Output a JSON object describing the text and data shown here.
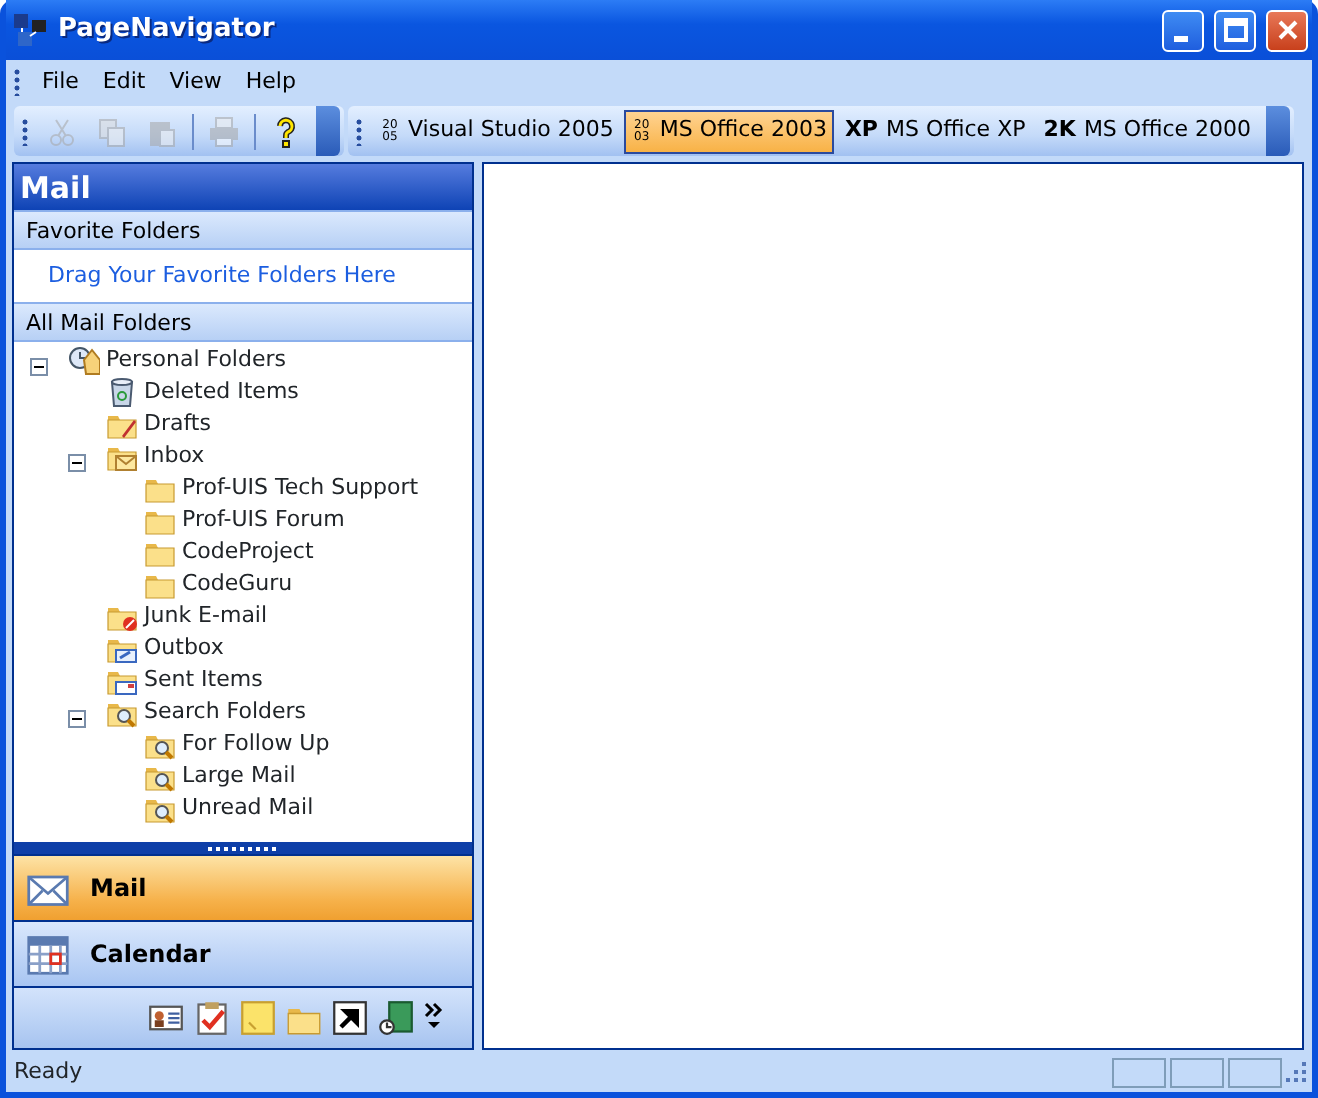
{
  "window": {
    "title": "PageNavigator"
  },
  "menu": [
    "File",
    "Edit",
    "View",
    "Help"
  ],
  "toolbar": [
    {
      "kind": "cut",
      "disabled": true
    },
    {
      "kind": "copy",
      "disabled": true
    },
    {
      "kind": "paste",
      "disabled": true
    },
    {
      "kind": "sep"
    },
    {
      "kind": "print",
      "disabled": true
    },
    {
      "kind": "sep"
    },
    {
      "kind": "help",
      "disabled": false
    }
  ],
  "themes": [
    {
      "badge": "2005",
      "label": "Visual Studio 2005",
      "selected": false
    },
    {
      "badge": "2003",
      "label": "MS Office 2003",
      "selected": true
    },
    {
      "badge": "XP",
      "label": "MS Office XP",
      "selected": false
    },
    {
      "badge": "2K",
      "label": "MS Office 2000",
      "selected": false
    }
  ],
  "pane": {
    "title": "Mail",
    "favorites_header": "Favorite Folders",
    "favorites_hint": "Drag Your Favorite Folders Here",
    "all_header": "All Mail Folders",
    "tree": [
      {
        "label": "Personal Folders",
        "kind": "personal",
        "expanded": true,
        "children": [
          {
            "label": "Deleted Items",
            "kind": "deleted"
          },
          {
            "label": "Drafts",
            "kind": "drafts"
          },
          {
            "label": "Inbox",
            "kind": "inbox",
            "expanded": true,
            "children": [
              {
                "label": "Prof-UIS Tech Support",
                "kind": "folder"
              },
              {
                "label": "Prof-UIS Forum",
                "kind": "folder"
              },
              {
                "label": "CodeProject",
                "kind": "folder"
              },
              {
                "label": "CodeGuru",
                "kind": "folder"
              }
            ]
          },
          {
            "label": "Junk E-mail",
            "kind": "junk"
          },
          {
            "label": "Outbox",
            "kind": "outbox"
          },
          {
            "label": "Sent Items",
            "kind": "sent"
          },
          {
            "label": "Search Folders",
            "kind": "search",
            "expanded": true,
            "children": [
              {
                "label": "For Follow Up",
                "kind": "search"
              },
              {
                "label": "Large Mail",
                "kind": "search"
              },
              {
                "label": "Unread Mail",
                "kind": "search"
              }
            ]
          }
        ]
      }
    ],
    "nav_buttons": [
      {
        "label": "Mail",
        "kind": "mail",
        "selected": true
      },
      {
        "label": "Calendar",
        "kind": "calendar",
        "selected": false
      }
    ],
    "shortcuts": [
      {
        "kind": "contacts"
      },
      {
        "kind": "tasks"
      },
      {
        "kind": "notes"
      },
      {
        "kind": "folder"
      },
      {
        "kind": "shortcut"
      },
      {
        "kind": "journal"
      }
    ]
  },
  "status_bar": {
    "text": "Ready"
  }
}
